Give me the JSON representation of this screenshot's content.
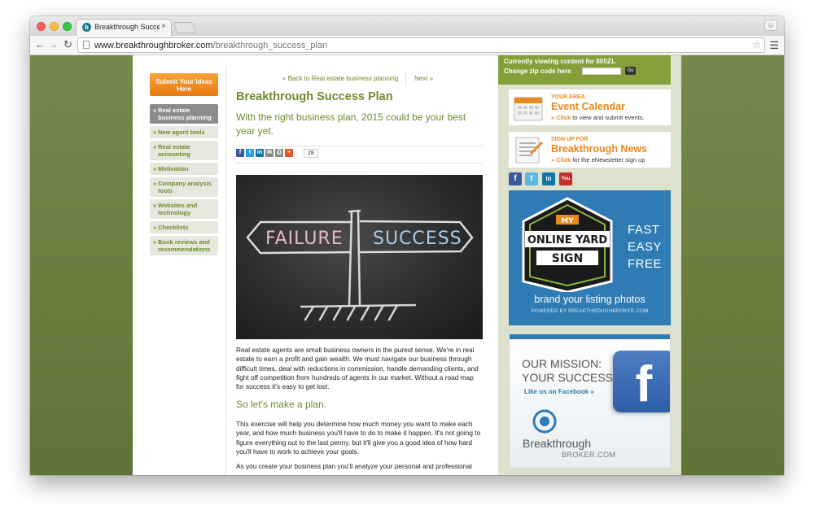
{
  "browser": {
    "tab_title": "Breakthrough Success Pla",
    "tab_close": "×",
    "url_domain": "www.breakthroughbroker.com",
    "url_path": "/breakthrough_success_plan"
  },
  "left_sidebar": {
    "submit_button": "Submit Your Ideas Here",
    "nav_items": [
      {
        "label": "Real estate business planning",
        "active": true
      },
      {
        "label": "New agent tools",
        "active": false
      },
      {
        "label": "Real estate accounting",
        "active": false
      },
      {
        "label": "Motivation",
        "active": false
      },
      {
        "label": "Company analysis tools",
        "active": false
      },
      {
        "label": "Websites and technology",
        "active": false
      },
      {
        "label": "Checklists",
        "active": false
      },
      {
        "label": "Book reviews and recommendations",
        "active": false
      }
    ]
  },
  "article": {
    "back_link": "« Back to Real estate business planning",
    "next_link": "Next »",
    "title": "Breakthrough Success Plan",
    "subtitle": "With the right business plan, 2015 could be your best year yet.",
    "share_count": "28",
    "image_sign_left": "FAILURE",
    "image_sign_right": "SUCCESS",
    "paragraph1": "Real estate agents are small business owners in the purest sense. We're in real estate to earn a profit and gain wealth. We must navigate our business through difficult times, deal with reductions in commission, handle demanding clients, and fight off competition from hundreds of agents in our market. Without a road map for success it's easy to get lost.",
    "section_heading": "So let's make a plan.",
    "paragraph2": "This exercise will help you determine how much money you want to make each year, and how much business you'll have to do to make it happen. It's not going to figure everything out to the last penny, but it'll give you a good idea of how hard you'll have to work to achieve your goals.",
    "paragraph3": "As you create your business plan you'll analyze your personal and professional"
  },
  "right_sidebar": {
    "zip_line1": "Currently viewing content for 80521.",
    "zip_line2": "Change zip code here",
    "zip_go": "Go",
    "event_kicker": "YOUR AREA",
    "event_title": "Event Calendar",
    "event_text_link": "» Click",
    "event_text_rest": " to view and submit events.",
    "news_kicker": "SIGN UP FOR",
    "news_title": "Breakthrough News",
    "news_text_link": "» Click",
    "news_text_rest": " for the eNewsletter sign up",
    "social_icons": [
      "facebook-icon",
      "twitter-icon",
      "linkedin-icon",
      "youtube-icon"
    ],
    "yard_ad": {
      "my": "MY",
      "online": "ONLINE YARD",
      "sign": "SIGN",
      "fast": "FAST",
      "easy": "EASY",
      "free": "FREE",
      "brand": "brand your listing photos",
      "powered": "POWERED BY BREAKTHROUGHBROKER.COM"
    },
    "mission_ad": {
      "line1": "OUR MISSION:",
      "line2": "YOUR SUCCESS",
      "like": "Like us on Facebook »",
      "fb_letter": "f",
      "logo_name": "Breakthrough",
      "logo_sub": "BROKER.COM"
    }
  },
  "colors": {
    "accent_green": "#6f8a2b",
    "orange": "#e9891d",
    "page_background": "#6a7d3f",
    "ad_blue": "#2f7bb3"
  }
}
